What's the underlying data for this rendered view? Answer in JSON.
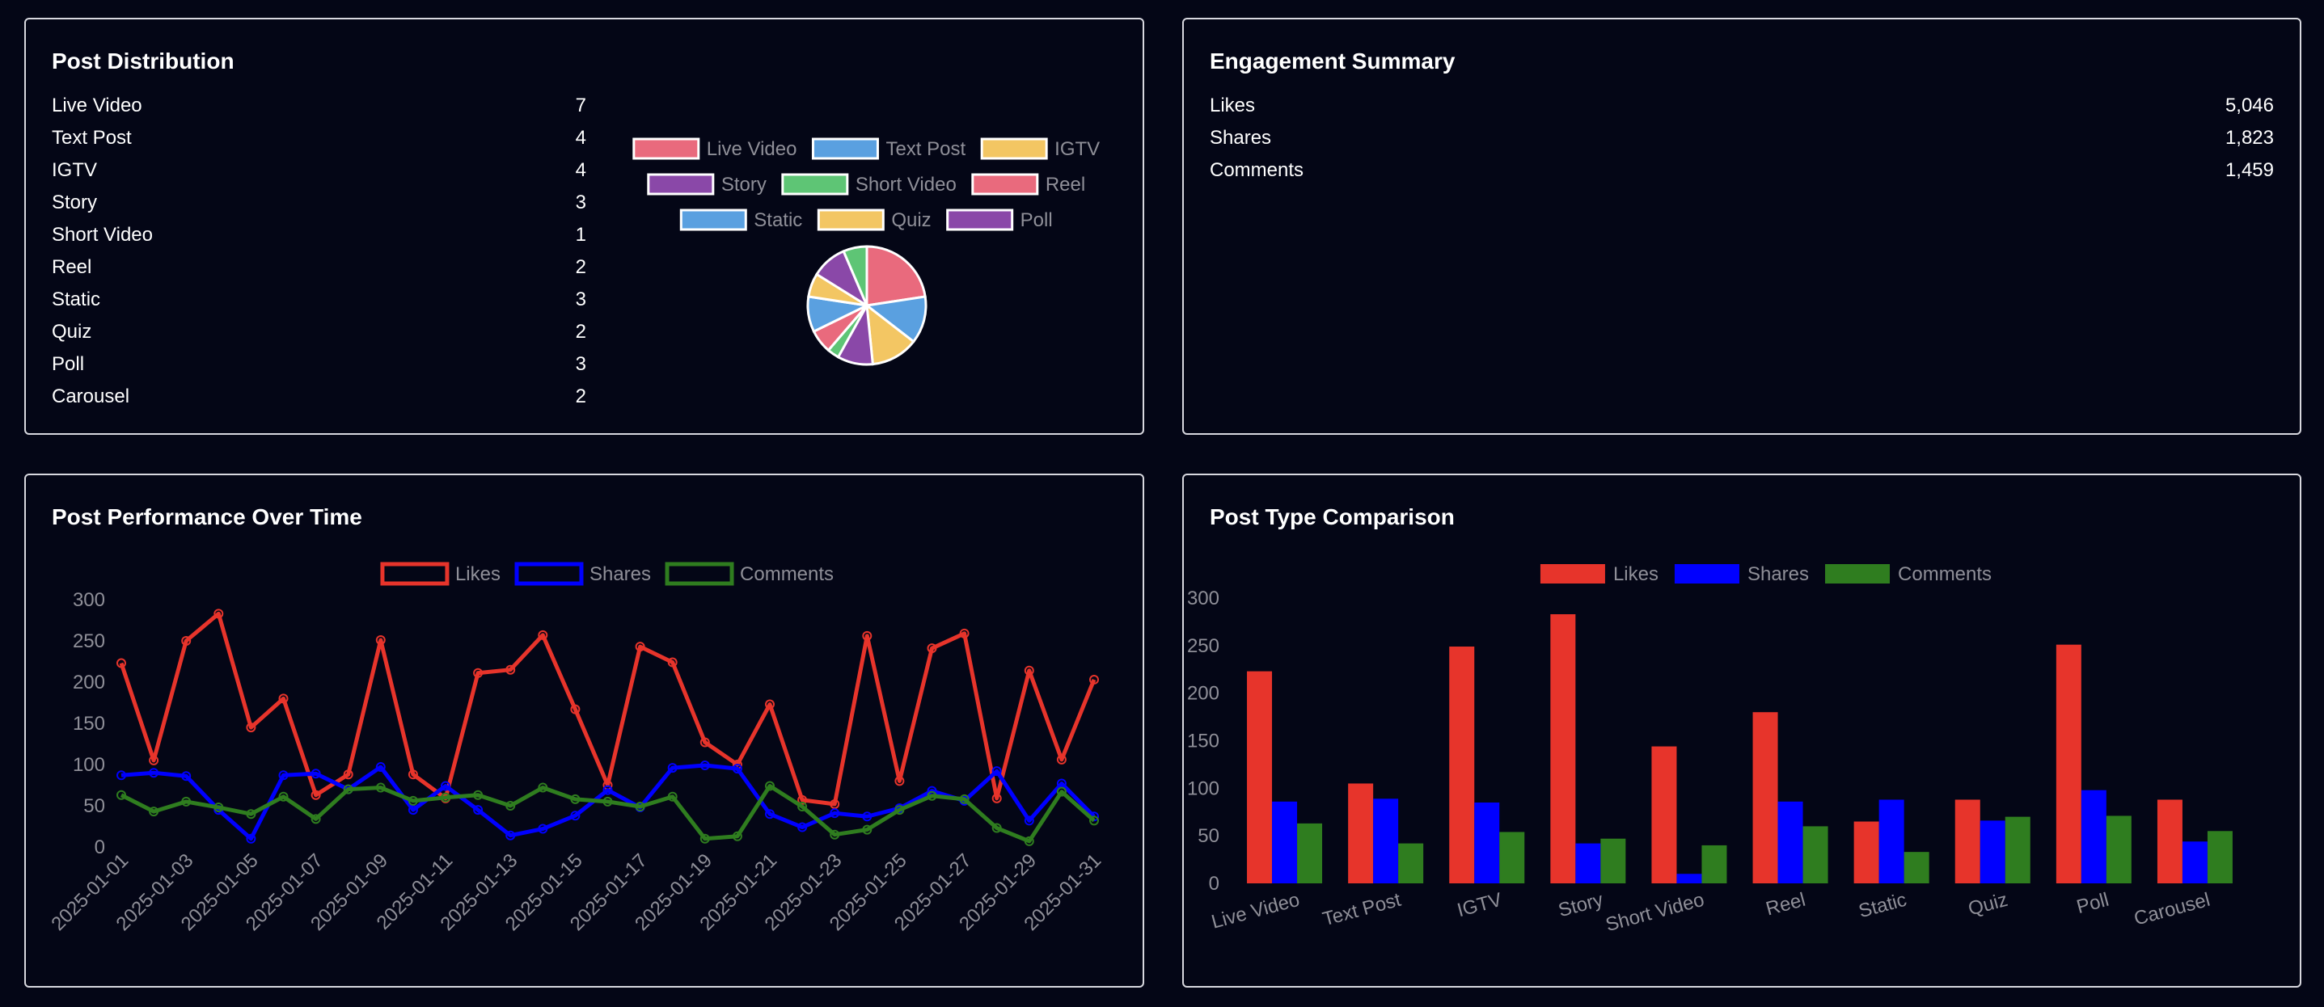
{
  "colors": {
    "background": "#040616",
    "likes": "#e7342b",
    "shares": "#0000ff",
    "comments": "#2f7d1f",
    "pie": [
      "#e96a7d",
      "#5aa0e0",
      "#f3c663",
      "#8a48a8",
      "#5ec575",
      "#e96a7d",
      "#5aa0e0",
      "#f3c663",
      "#8a48a8",
      "#5ec575"
    ]
  },
  "post_distribution": {
    "title": "Post Distribution",
    "items": [
      {
        "label": "Live Video",
        "value": "7"
      },
      {
        "label": "Text Post",
        "value": "4"
      },
      {
        "label": "IGTV",
        "value": "4"
      },
      {
        "label": "Story",
        "value": "3"
      },
      {
        "label": "Short Video",
        "value": "1"
      },
      {
        "label": "Reel",
        "value": "2"
      },
      {
        "label": "Static",
        "value": "3"
      },
      {
        "label": "Quiz",
        "value": "2"
      },
      {
        "label": "Poll",
        "value": "3"
      },
      {
        "label": "Carousel",
        "value": "2"
      }
    ]
  },
  "engagement_summary": {
    "title": "Engagement Summary",
    "items": [
      {
        "label": "Likes",
        "value": "5,046"
      },
      {
        "label": "Shares",
        "value": "1,823"
      },
      {
        "label": "Comments",
        "value": "1,459"
      }
    ]
  },
  "performance": {
    "title": "Post Performance Over Time"
  },
  "comparison": {
    "title": "Post Type Comparison"
  },
  "chart_data": [
    {
      "type": "pie",
      "legend_position": "top",
      "labels": [
        "Live Video",
        "Text Post",
        "IGTV",
        "Story",
        "Short Video",
        "Reel",
        "Static",
        "Quiz",
        "Poll",
        "Carousel"
      ],
      "legend_labels": [
        "Live Video",
        "Text Post",
        "IGTV",
        "Story",
        "Short Video",
        "Reel",
        "Static",
        "Quiz",
        "Poll"
      ],
      "values": [
        7,
        4,
        4,
        3,
        1,
        2,
        3,
        2,
        3,
        2
      ]
    },
    {
      "type": "line",
      "legend_position": "top",
      "x": [
        "2025-01-01",
        "2025-01-02",
        "2025-01-03",
        "2025-01-04",
        "2025-01-05",
        "2025-01-06",
        "2025-01-07",
        "2025-01-08",
        "2025-01-09",
        "2025-01-10",
        "2025-01-11",
        "2025-01-12",
        "2025-01-13",
        "2025-01-14",
        "2025-01-15",
        "2025-01-16",
        "2025-01-17",
        "2025-01-18",
        "2025-01-19",
        "2025-01-20",
        "2025-01-21",
        "2025-01-22",
        "2025-01-23",
        "2025-01-24",
        "2025-01-25",
        "2025-01-26",
        "2025-01-27",
        "2025-01-28",
        "2025-01-29",
        "2025-01-30",
        "2025-01-31"
      ],
      "x_tick_labels": [
        "2025-01-01",
        "2025-01-03",
        "2025-01-05",
        "2025-01-07",
        "2025-01-09",
        "2025-01-11",
        "2025-01-13",
        "2025-01-15",
        "2025-01-17",
        "2025-01-19",
        "2025-01-21",
        "2025-01-23",
        "2025-01-25",
        "2025-01-27",
        "2025-01-29",
        "2025-01-31"
      ],
      "y_ticks": [
        0,
        50,
        100,
        150,
        200,
        250,
        300
      ],
      "ylim": [
        0,
        300
      ],
      "series": [
        {
          "name": "Likes",
          "values": [
            223,
            105,
            250,
            283,
            145,
            180,
            63,
            88,
            251,
            88,
            59,
            211,
            215,
            257,
            167,
            75,
            243,
            224,
            127,
            100,
            173,
            57,
            52,
            256,
            80,
            241,
            259,
            59,
            214,
            106,
            203
          ]
        },
        {
          "name": "Shares",
          "values": [
            87,
            90,
            86,
            45,
            10,
            87,
            89,
            70,
            97,
            45,
            74,
            45,
            14,
            22,
            38,
            69,
            48,
            96,
            99,
            95,
            40,
            24,
            41,
            37,
            47,
            68,
            56,
            92,
            32,
            77,
            37
          ]
        },
        {
          "name": "Comments",
          "values": [
            63,
            43,
            55,
            48,
            40,
            61,
            34,
            70,
            72,
            56,
            60,
            63,
            50,
            72,
            58,
            55,
            49,
            61,
            10,
            13,
            74,
            49,
            15,
            21,
            45,
            62,
            58,
            23,
            7,
            67,
            32
          ]
        }
      ]
    },
    {
      "type": "bar",
      "legend_position": "top",
      "categories": [
        "Live Video",
        "Text Post",
        "IGTV",
        "Story",
        "Short Video",
        "Reel",
        "Static",
        "Quiz",
        "Poll",
        "Carousel"
      ],
      "y_ticks": [
        0,
        50,
        100,
        150,
        200,
        250,
        300
      ],
      "ylim": [
        0,
        300
      ],
      "series": [
        {
          "name": "Likes",
          "values": [
            223,
            105,
            249,
            283,
            144,
            180,
            65,
            88,
            251,
            88
          ]
        },
        {
          "name": "Shares",
          "values": [
            86,
            89,
            85,
            42,
            10,
            86,
            88,
            66,
            98,
            44
          ]
        },
        {
          "name": "Comments",
          "values": [
            63,
            42,
            54,
            47,
            40,
            60,
            33,
            70,
            71,
            55
          ]
        }
      ]
    }
  ]
}
